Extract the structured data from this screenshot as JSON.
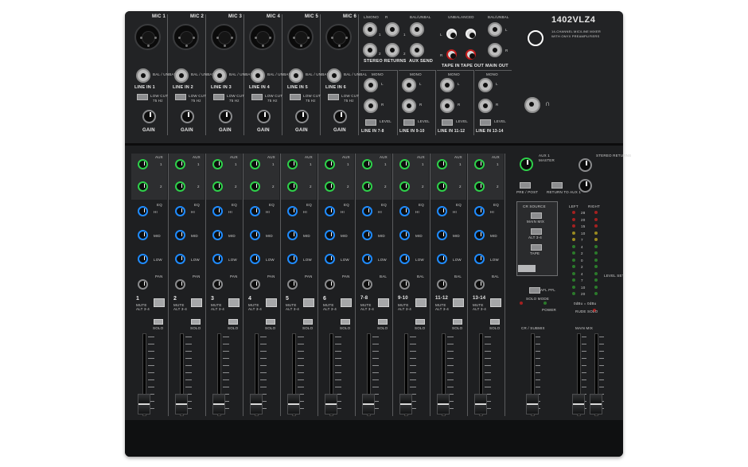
{
  "brand": {
    "model": "1402VLZ4",
    "description_line1": "14-CHANNEL MIC/LINE MIXER",
    "description_line2": "WITH ONYX PREAMPLIFIERS"
  },
  "mic_inputs": [
    {
      "label": "MIC 1",
      "line_label": "LINE IN 1"
    },
    {
      "label": "MIC 2",
      "line_label": "LINE IN 2"
    },
    {
      "label": "MIC 3",
      "line_label": "LINE IN 3"
    },
    {
      "label": "MIC 4",
      "line_label": "LINE IN 4"
    },
    {
      "label": "MIC 5",
      "line_label": "LINE IN 5"
    },
    {
      "label": "MIC 6",
      "line_label": "LINE IN 6"
    }
  ],
  "input_labels": {
    "bal_unbal": "BAL / UNBAL",
    "low_cut": "LOW CUT",
    "low_cut_freq": "75 Hz",
    "gain": "GAIN",
    "level": "LEVEL",
    "mono": "MONO",
    "l_mono": "L/MONO",
    "bal_unbal_short": "BAL/UNBAL",
    "unbalanced": "UNBALANCED",
    "stereo_returns": "STEREO RETURNS",
    "aux_send": "AUX SEND",
    "tape_in": "TAPE IN",
    "tape_out": "TAPE OUT",
    "main_out": "MAIN OUT",
    "stereo_line_labels": [
      "LINE IN 7-8",
      "LINE IN 9-10",
      "LINE IN 11-12",
      "LINE IN 13-14"
    ]
  },
  "channel_labels": {
    "aux": "AUX",
    "eq": "EQ",
    "hi": "HI",
    "mid": "MID",
    "low": "LOW",
    "pan": "PAN",
    "bal": "BAL",
    "mute": "MUTE",
    "alt": "ALT 3-4",
    "solo": "SOLO"
  },
  "channels": [
    "1",
    "2",
    "3",
    "4",
    "5",
    "6",
    "7-8",
    "9-10",
    "11-12",
    "13-14"
  ],
  "master": {
    "aux1_master": "AUX 1",
    "master": "MASTER",
    "stereo_returns": "STEREO RETURNS",
    "pre_post": "PRE / POST",
    "return_to_aux1": "RETURN TO AUX 1",
    "cr_source": "CR SOURCE",
    "main_mix": "MAIN MIX",
    "alt_3_4": "ALT 3-4",
    "tape": "TAPE",
    "phones": "CR / PHONES",
    "solo_mode": "SOLO MODE",
    "afl_pfl": "AFL PFL",
    "power": "POWER",
    "rude_solo": "RUDE SOLO",
    "left": "LEFT",
    "right": "RIGHT",
    "level_set": "LEVEL SET",
    "zero_db": "0dBu = 0dBu",
    "cr_submix": "CR / SUBMIX",
    "main_mix_fader": "MAIN MIX"
  },
  "meter_scale": [
    "28",
    "20",
    "15",
    "10",
    "7",
    "4",
    "2",
    "0",
    "2",
    "4",
    "7",
    "10",
    "20"
  ],
  "fader_scale": [
    "10",
    "5",
    "U",
    "5",
    "10",
    "20",
    "30",
    "40",
    "50",
    "60",
    "∞"
  ],
  "colors": {
    "aux_knob": "#2ed04a",
    "eq_knob": "#1f8bff",
    "pan_knob": "#8a8b8d",
    "body": "#1b1c1d"
  }
}
